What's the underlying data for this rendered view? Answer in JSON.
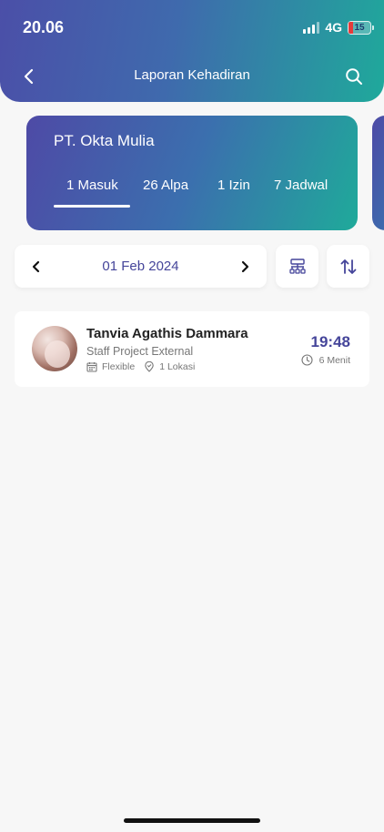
{
  "status_bar": {
    "time": "20.06",
    "network": "4G",
    "battery": "15"
  },
  "header": {
    "title": "Laporan Kehadiran"
  },
  "company_card": {
    "name": "PT. Okta Mulia",
    "stats": [
      {
        "label": "1 Masuk",
        "active": true
      },
      {
        "label": "26 Alpa"
      },
      {
        "label": "1 Izin"
      },
      {
        "label": "7 Jadwal"
      }
    ]
  },
  "date_nav": {
    "date": "01 Feb 2024"
  },
  "employees": [
    {
      "name": "Tanvia Agathis Dammara",
      "role": "Staff Project External",
      "schedule": "Flexible",
      "location": "1 Lokasi",
      "time": "19:48",
      "duration": "6 Menit"
    }
  ],
  "icons": {
    "back": "chevron-left-icon",
    "search": "search-icon",
    "prev": "chevron-left-icon",
    "next": "chevron-right-icon",
    "org": "org-structure-icon",
    "sort": "sort-arrows-icon",
    "calendar": "calendar-icon",
    "location": "location-pin-icon",
    "clock": "clock-icon"
  },
  "colors": {
    "accent": "#45459a",
    "gradient_start": "#4b4fa8",
    "gradient_end": "#1fa99b"
  }
}
